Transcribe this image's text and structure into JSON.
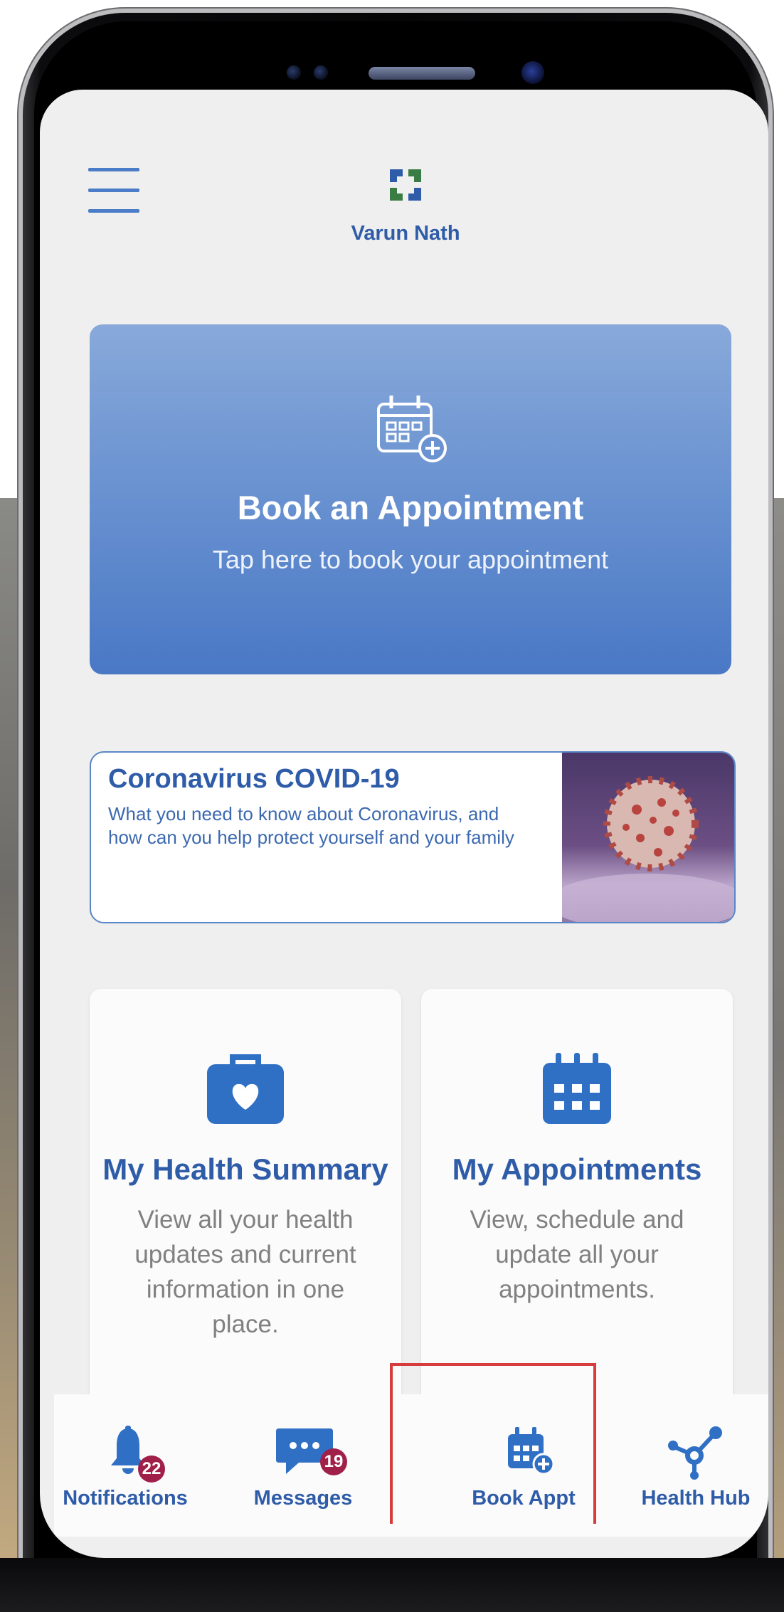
{
  "header": {
    "user_name": "Varun Nath"
  },
  "book_card": {
    "title": "Book an Appointment",
    "subtitle": "Tap here to book your appointment"
  },
  "covid_card": {
    "title": "Coronavirus COVID-19",
    "text": "What you need to know about Coronavirus, and how can you help protect yourself and your family"
  },
  "tiles": [
    {
      "title": "My Health Summary",
      "desc": "View all your health updates and current information in one place."
    },
    {
      "title": "My Appointments",
      "desc": "View, schedule and update all your appointments."
    }
  ],
  "nav": [
    {
      "label": "Notifications",
      "badge": "22",
      "icon": "bell-icon"
    },
    {
      "label": "Messages",
      "badge": "19",
      "icon": "chat-icon"
    },
    {
      "label": "Book Appt",
      "icon": "calendar-plus-icon"
    },
    {
      "label": "Health Hub",
      "icon": "hub-icon"
    }
  ],
  "colors": {
    "primary": "#2f5ca8",
    "card_gradient_top": "#88a9da",
    "card_gradient_bottom": "#4978c5",
    "badge": "#a0204a",
    "highlight": "#d83b3b",
    "logo_green": "#3a7d44",
    "logo_blue": "#2f5ca8"
  }
}
